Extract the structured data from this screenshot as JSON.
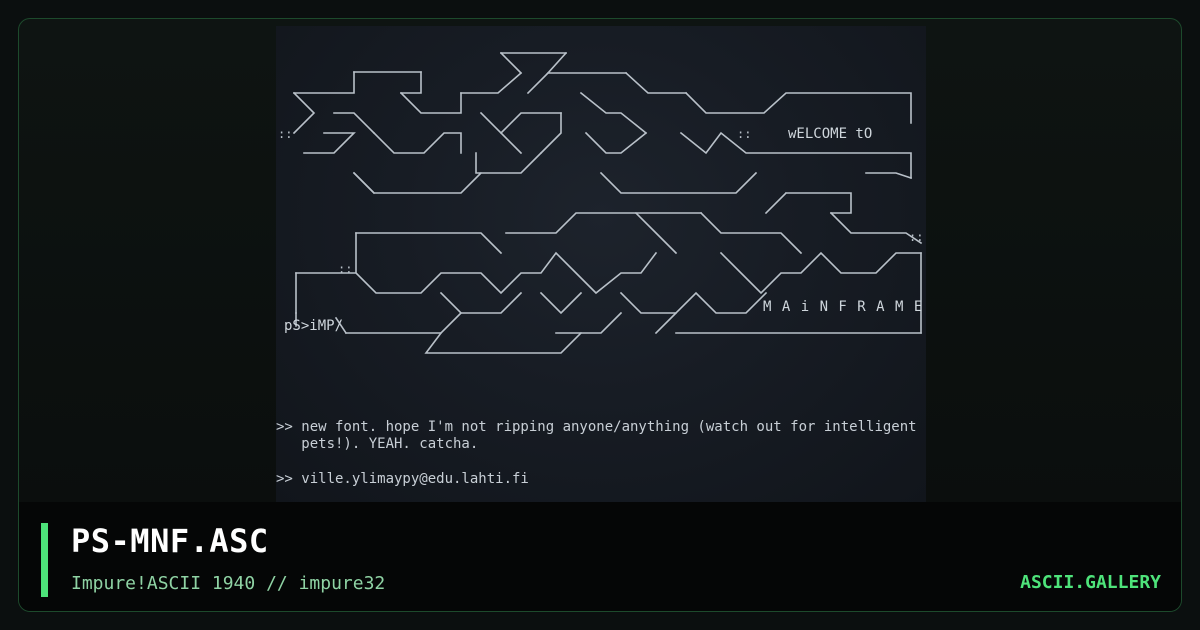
{
  "artwork": {
    "welcome_text": "wELCOME tO",
    "mainframe_text": "M A i N F R A M E",
    "signature_text": "pS>iMP/",
    "notes": [
      ">> new font. hope I'm not ripping anyone/anything (watch out for intelligent",
      "   pets!). YEAH. catcha.",
      ">> ville.ylimaypy@edu.lahti.fi"
    ]
  },
  "info": {
    "title": "PS-MNF.ASC",
    "subtitle": "Impure!ASCII 1940 // impure32",
    "brand": "ASCII.GALLERY"
  },
  "colors": {
    "accent": "#4ee37a",
    "art_fg": "#c8cfd6",
    "art_bg": "#171c24"
  }
}
